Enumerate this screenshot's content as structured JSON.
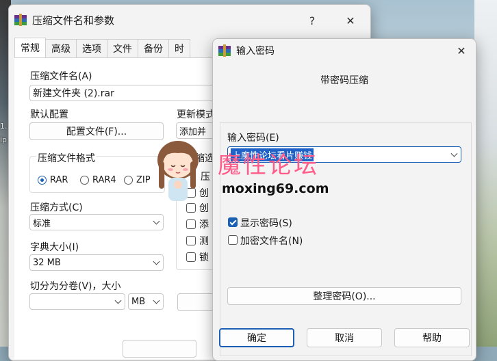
{
  "main_window": {
    "title": "压缩文件名和参数",
    "help_glyph": "?",
    "close_glyph": "✕",
    "tabs": [
      "常规",
      "高级",
      "选项",
      "文件",
      "备份",
      "时"
    ],
    "archive_name_label": "压缩文件名(A)",
    "archive_name_value": "新建文件夹 (2).rar",
    "default_profile_label": "默认配置",
    "profile_button": "配置文件(F)...",
    "update_mode_label": "更新模式",
    "update_mode_value": "添加并",
    "format_group_label": "压缩文件格式",
    "formats": [
      "RAR",
      "RAR4",
      "ZIP"
    ],
    "options_group_label": "缩选",
    "option_partial": [
      "压",
      "创",
      "创",
      "添",
      "测",
      "锁"
    ],
    "method_label": "压缩方式(C)",
    "method_value": "标准",
    "dict_label": "字典大小(I)",
    "dict_value": "32 MB",
    "split_label": "切分为分卷(V)，大小",
    "split_value": "",
    "split_unit": "MB"
  },
  "password_dialog": {
    "title": "输入密码",
    "close_glyph": "✕",
    "heading": "带密码压缩",
    "enter_label": "输入密码(E)",
    "password_value": "上魔性论坛看片赚钱",
    "show_password_label": "显示密码(S)",
    "show_password_checked": true,
    "encrypt_names_label": "加密文件名(N)",
    "encrypt_names_checked": false,
    "organize_button": "整理密码(O)...",
    "ok_button": "确定",
    "cancel_button": "取消",
    "help_button": "帮助"
  },
  "watermark": {
    "title": "魔性论坛",
    "url": "moxing69.com"
  },
  "desktop": {
    "left_text_1": "1...",
    "left_text_2": "ip"
  }
}
